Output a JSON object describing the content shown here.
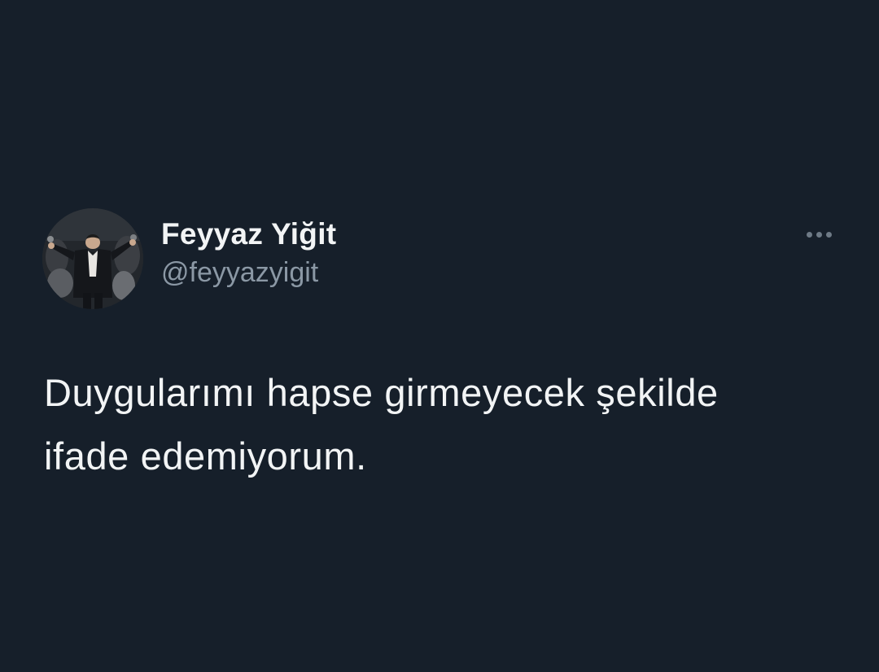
{
  "tweet": {
    "author": {
      "display_name": "Feyyaz Yiğit",
      "handle": "@feyyazyigit",
      "avatar_icon": "avatar-photo"
    },
    "more_icon": "more-horizontal-icon",
    "text": "Duygularımı hapse girmeyecek şekilde\nifade edemiyorum."
  },
  "colors": {
    "background": "#161f2a",
    "primary_text": "#f2f4f5",
    "secondary_text": "#8b98a5"
  }
}
